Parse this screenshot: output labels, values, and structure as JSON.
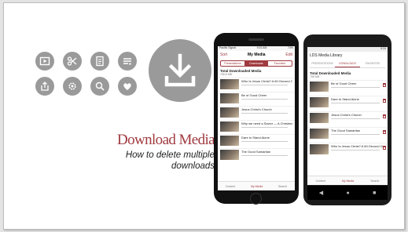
{
  "headline": "Download Media",
  "subtitle": "How to delete multiple downloads",
  "icons": [
    "video-icon",
    "scissors-icon",
    "document-icon",
    "playlist-icon",
    "share-icon",
    "gear-icon",
    "search-icon",
    "heart-icon"
  ],
  "big_icon": "download-icon",
  "accent": "#a03a3f",
  "iphone": {
    "carrier": "Pacific Signal",
    "time": "9:31 AM",
    "battery": "74%",
    "back": "Sort",
    "title": "My Media",
    "edit": "Edit",
    "segments": [
      "Presentations",
      "Downloads",
      "Favorites"
    ],
    "section_title": "Total Downloaded Media",
    "section_sub": "755.8 MB",
    "items": [
      "Who Is Jesus Christ? A 60-Second Overview",
      "Be of Good Cheer",
      "Jesus Christ's Church",
      "Why we need a Savior — A Christmas Message",
      "Dare to Stand Alone",
      "The Good Samaritan"
    ],
    "tabs": [
      "Content",
      "My Media",
      "Search"
    ]
  },
  "android": {
    "time": "9:24",
    "title": "LDS Media Library",
    "tabs": [
      "PRESENTATIONS",
      "DOWNLOADS",
      "FAVORITES"
    ],
    "section_title": "Total Downloaded Media",
    "section_sub": "755 MB",
    "items": [
      "Be of Good Cheer",
      "Dare to Stand Alone",
      "Jesus Christ's Church",
      "The Good Samaritan",
      "Who Is Jesus Christ? A 60-Second Overview"
    ],
    "bottom_tabs": [
      "Content",
      "My Media",
      "Search"
    ]
  }
}
